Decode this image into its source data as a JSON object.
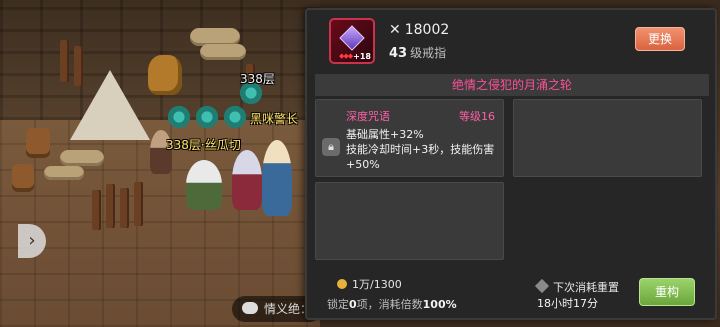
{
  "scene": {
    "name_tags": [
      "338层·丝瓜切",
      "黑咪警长",
      "338层·",
      "338层"
    ],
    "chat_text": "情义绝：",
    "chat_speaker_prefix": "",
    "side_arrow_icon": "chevron-right-icon"
  },
  "item": {
    "power": "18002",
    "level_number": "43",
    "level_suffix": "级戒指",
    "enhance": "+18",
    "replace_label": "更换"
  },
  "panel_title": "绝情之侵犯的月涌之轮",
  "slots": [
    {
      "name": "深度咒语",
      "level": "等级16",
      "effects": [
        "基础属性+32%",
        "技能冷却时间+3秒，技能伤害+50%"
      ]
    }
  ],
  "footer": {
    "cost": "1万/1300",
    "lock_text_prefix": "锁定",
    "lock_count": "0",
    "lock_text_mid": "项，消耗倍数",
    "lock_multiplier": "100%",
    "reset_label": "下次消耗重置",
    "reset_time": "18小时17分",
    "rebuild_label": "重构"
  },
  "colors": {
    "accent_pink": "#ff4f9a",
    "replace_button": "#d9633f",
    "rebuild_button": "#6aa63b"
  }
}
